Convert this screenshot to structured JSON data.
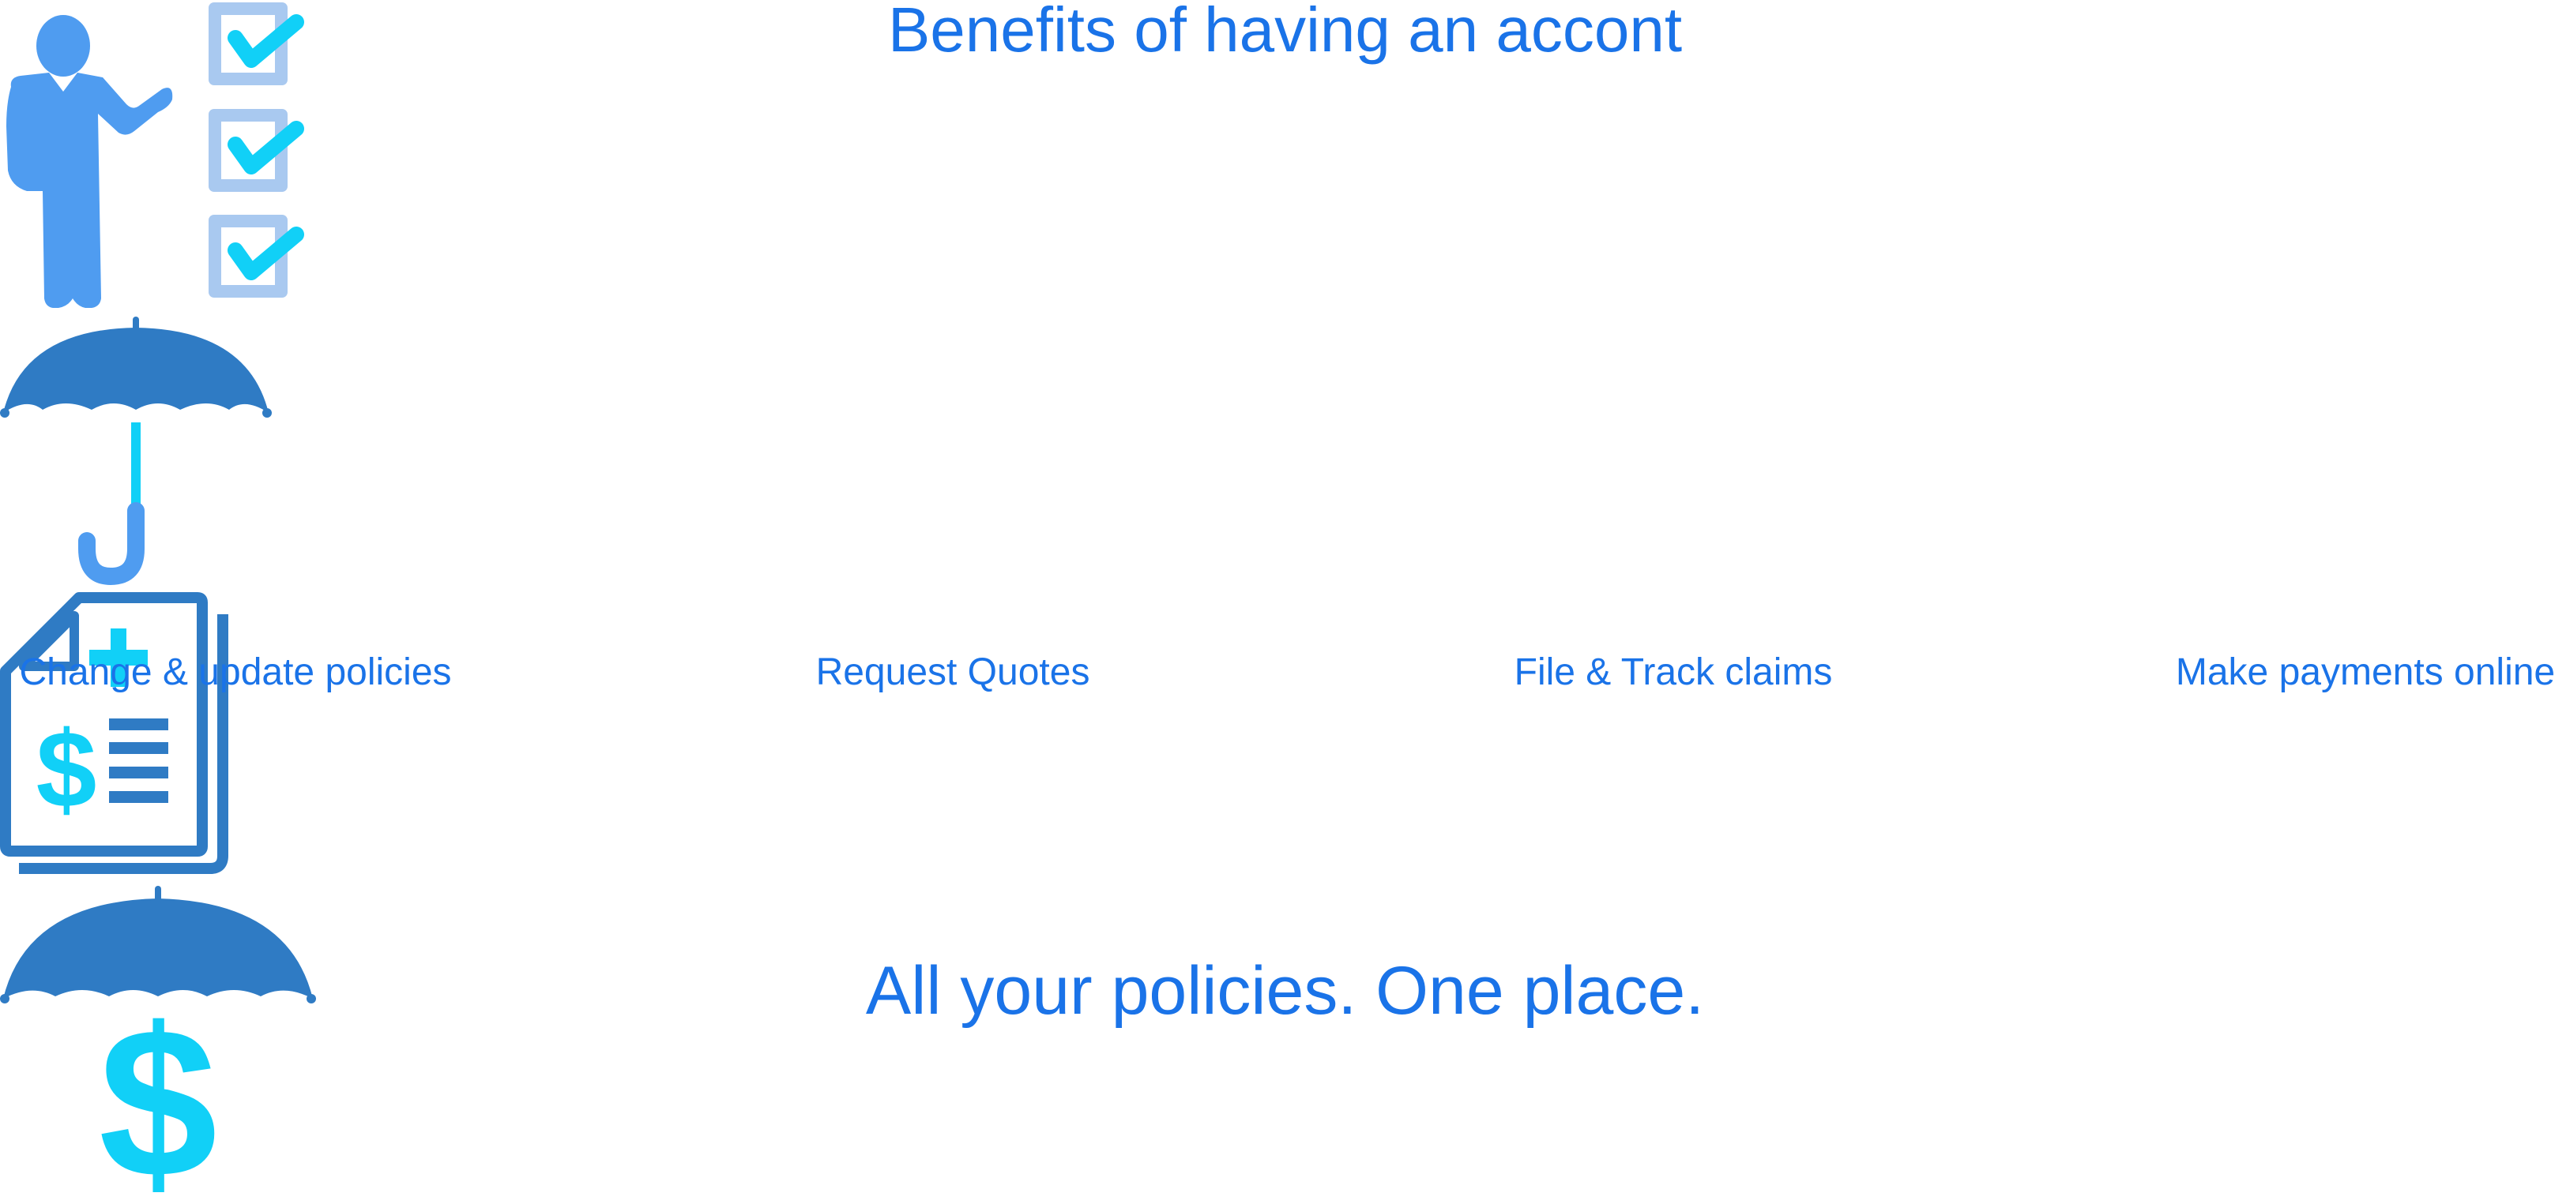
{
  "page": {
    "title": "Benefits of having an accont",
    "tagline": "All your policies. One place."
  },
  "colors": {
    "text": "#1a73e8",
    "icon_dark_blue": "#2f7bc4",
    "icon_light_blue": "#4f9cf0",
    "icon_pale_blue": "#a9c9f0",
    "icon_cyan": "#11d0f7"
  },
  "features": [
    {
      "label": "Change & update policies",
      "icon": "presenter-checklist-icon"
    },
    {
      "label": "Request Quotes",
      "icon": "umbrella-icon"
    },
    {
      "label": "File & Track claims",
      "icon": "medical-claim-document-icon"
    },
    {
      "label": "Make payments online",
      "icon": "umbrella-dollar-icon"
    }
  ]
}
